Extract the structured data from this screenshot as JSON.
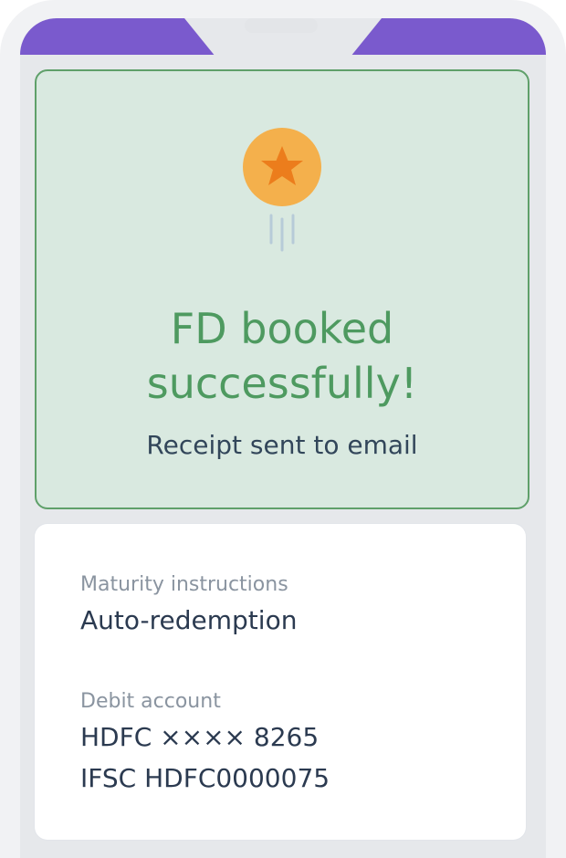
{
  "success": {
    "title": "FD booked\nsuccessfully!",
    "subtitle": "Receipt sent to email",
    "icon": "medal-star-icon"
  },
  "details": {
    "maturity_label": "Maturity instructions",
    "maturity_value": "Auto-redemption",
    "debit_label": "Debit account",
    "debit_account": "HDFC ×××× 8265",
    "debit_ifsc": "IFSC HDFC0000075"
  },
  "colors": {
    "header": "#7a5acd",
    "success_bg": "#d9e9e0",
    "success_border": "#5fa06a",
    "success_text": "#4e9a60",
    "medal_outer": "#f4b04c",
    "medal_star": "#ec7d1c"
  }
}
